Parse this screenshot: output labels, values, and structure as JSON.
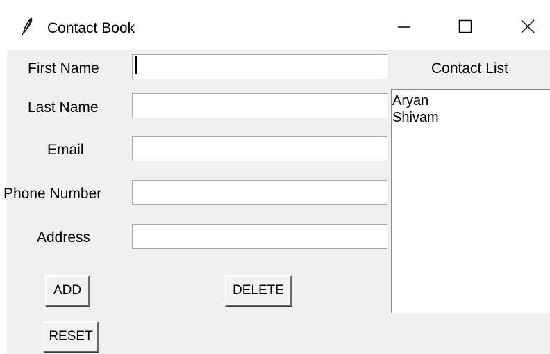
{
  "window": {
    "title": "Contact Book",
    "icon": "feather-icon",
    "controls": [
      "minimize-icon",
      "maximize-icon",
      "close-icon"
    ]
  },
  "form": {
    "first_name": {
      "label": "First Name",
      "value": ""
    },
    "last_name": {
      "label": "Last Name",
      "value": ""
    },
    "email": {
      "label": "Email",
      "value": ""
    },
    "phone": {
      "label": "Phone Number",
      "value": ""
    },
    "address": {
      "label": "Address",
      "value": ""
    }
  },
  "contact_list": {
    "heading": "Contact List",
    "items": [
      "Aryan",
      "Shivam"
    ]
  },
  "buttons": {
    "add": "ADD",
    "delete": "DELETE",
    "reset": "RESET"
  },
  "colors": {
    "window_background": "#f0f0f0",
    "titlebar": "#ffffff"
  }
}
